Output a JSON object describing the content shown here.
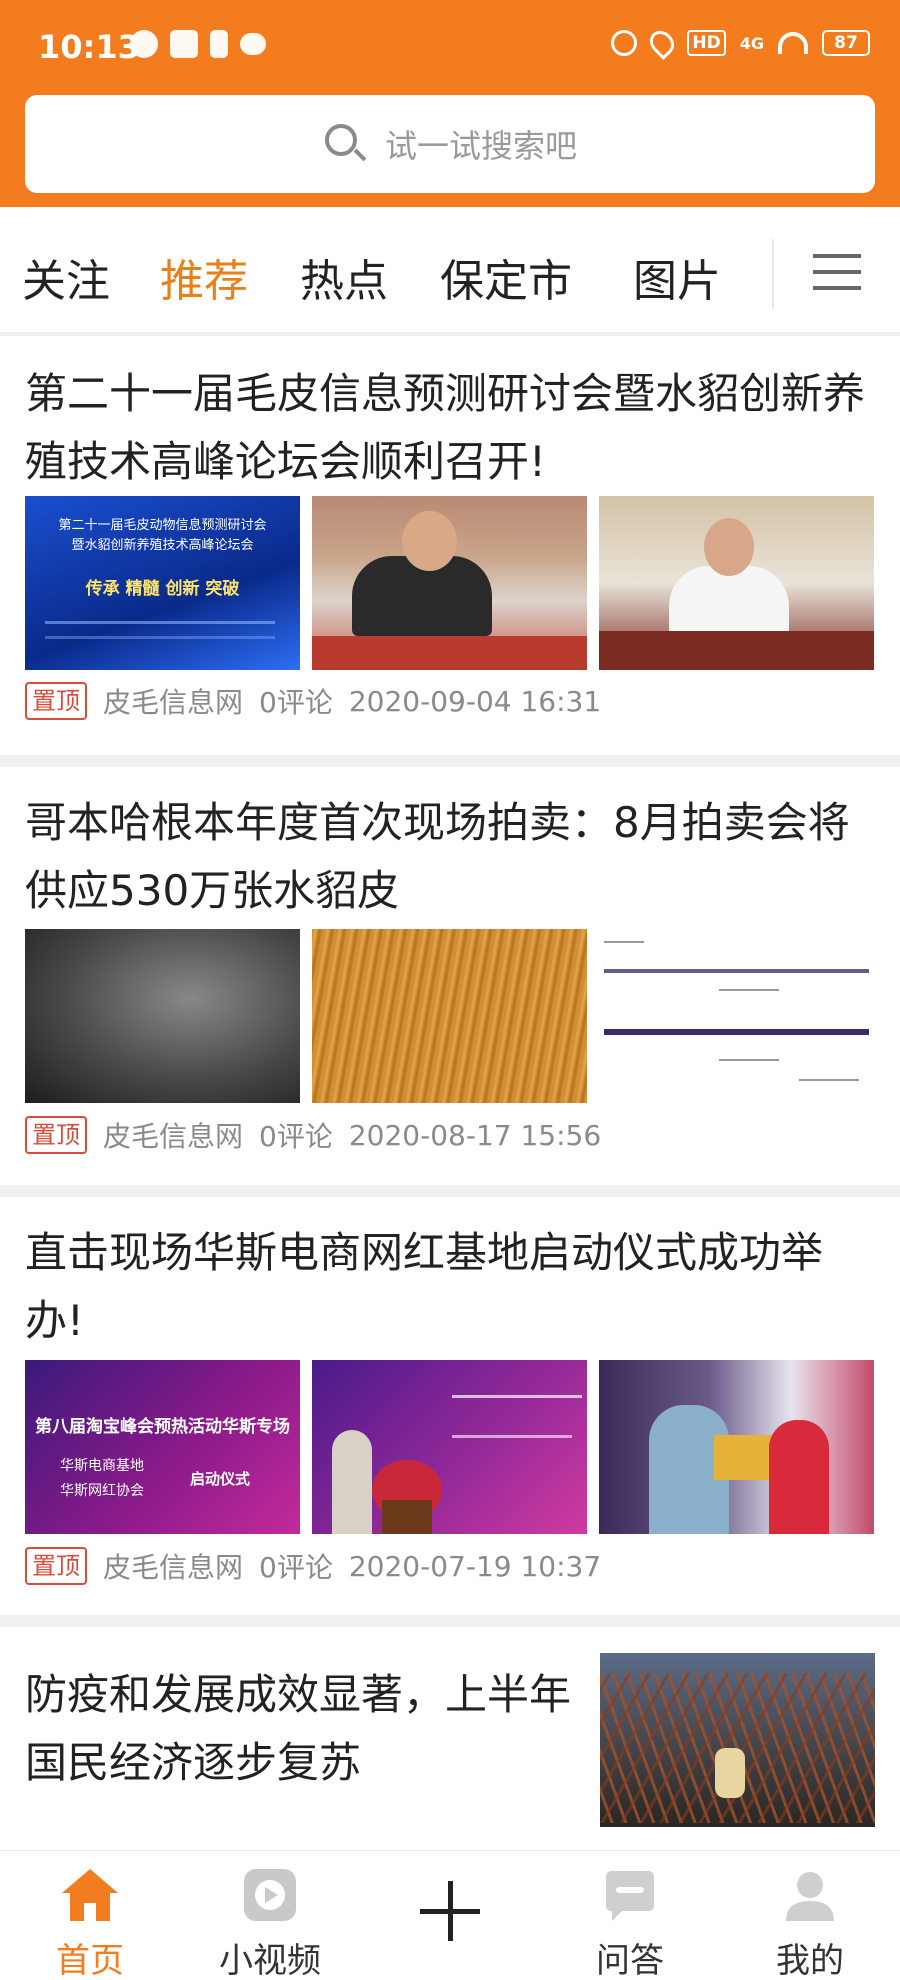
{
  "status": {
    "time": "10:13",
    "network": "4G",
    "hd": "HD",
    "battery": "87"
  },
  "search": {
    "placeholder": "试一试搜索吧"
  },
  "tabs": [
    {
      "label": "关注",
      "active": false
    },
    {
      "label": "推荐",
      "active": true
    },
    {
      "label": "热点",
      "active": false
    },
    {
      "label": "保定市",
      "active": false
    },
    {
      "label": "图片",
      "active": false
    }
  ],
  "articles": [
    {
      "title": "第二十一届毛皮信息预测研讨会暨水貂创新养殖技术高峰论坛会顺利召开!",
      "badge": "置顶",
      "source": "皮毛信息网",
      "comments": "0评论",
      "date": "2020-09-04 16:31",
      "banner_line1": "第二十一届毛皮动物信息预测研讨会",
      "banner_line2": "暨水貂创新养殖技术高峰论坛会",
      "banner_line3": "传承  精髓  创新  突破"
    },
    {
      "title": "哥本哈根本年度首次现场拍卖：8月拍卖会将供应530万张水貂皮",
      "badge": "置顶",
      "source": "皮毛信息网",
      "comments": "0评论",
      "date": "2020-08-17 15:56"
    },
    {
      "title": "直击现场华斯电商网红基地启动仪式成功举办!",
      "badge": "置顶",
      "source": "皮毛信息网",
      "comments": "0评论",
      "date": "2020-07-19 10:37",
      "banner_line1": "第八届淘宝峰会预热活动华斯专场",
      "banner_line2": "华斯电商基地",
      "banner_line3": "华斯网红协会",
      "banner_line4": "启动仪式"
    },
    {
      "title": "防疫和发展成效显著，上半年国民经济逐步复苏"
    }
  ],
  "bottom_nav": [
    {
      "label": "首页",
      "icon": "home-icon",
      "active": true
    },
    {
      "label": "小视频",
      "icon": "video-icon",
      "active": false
    },
    {
      "label": "",
      "icon": "plus-icon",
      "active": false
    },
    {
      "label": "问答",
      "icon": "qa-icon",
      "active": false
    },
    {
      "label": "我的",
      "icon": "profile-icon",
      "active": false
    }
  ],
  "colors": {
    "brand": "#f37d1e",
    "active_tab": "#e8801a",
    "badge": "#d94b3b"
  }
}
